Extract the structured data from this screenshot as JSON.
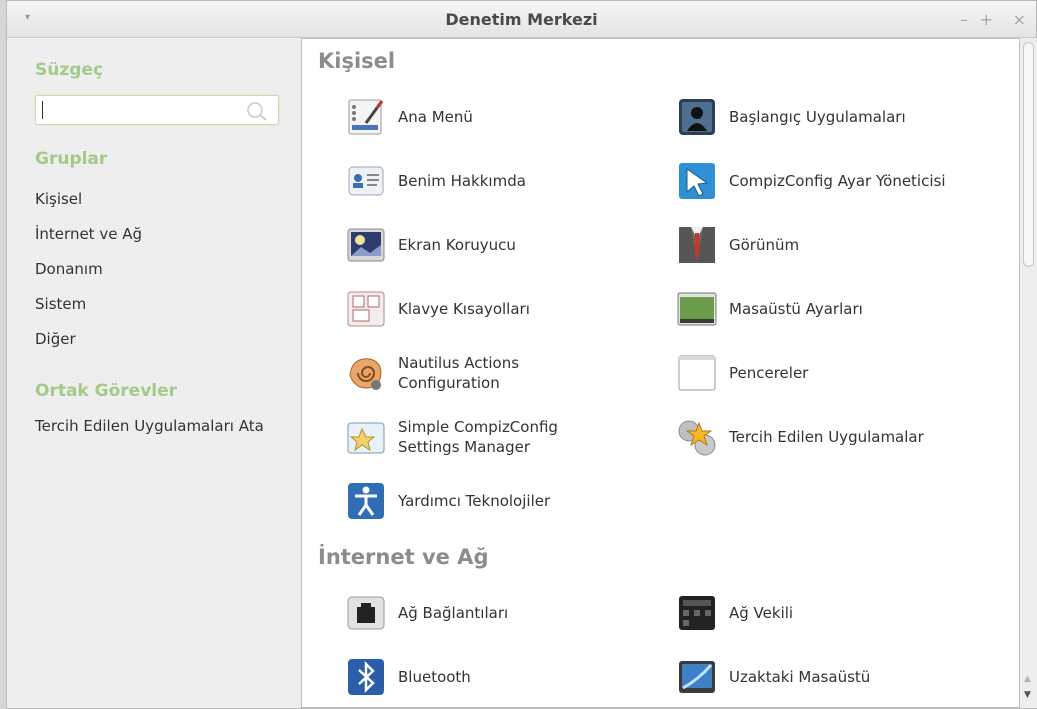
{
  "window": {
    "title": "Denetim Merkezi",
    "menu_glyph": "▾",
    "minimize_glyph": "–",
    "maximize_glyph": "+",
    "close_glyph": "×"
  },
  "sidebar": {
    "filter_heading": "Süzgeç",
    "search_value": "",
    "groups_heading": "Gruplar",
    "groups": [
      "Kişisel",
      "İnternet ve Ağ",
      "Donanım",
      "Sistem",
      "Diğer"
    ],
    "tasks_heading": "Ortak Görevler",
    "tasks": [
      "Tercih Edilen Uygulamaları Ata"
    ]
  },
  "sections": [
    {
      "title": "Kişisel",
      "items": [
        {
          "label": "Ana Menü",
          "icon": "main-menu-icon"
        },
        {
          "label": "Başlangıç Uygulamaları",
          "icon": "startup-apps-icon"
        },
        {
          "label": "Benim Hakkımda",
          "icon": "about-me-icon"
        },
        {
          "label": "CompizConfig Ayar Yöneticisi",
          "icon": "compizconfig-icon"
        },
        {
          "label": "Ekran Koruyucu",
          "icon": "screensaver-icon"
        },
        {
          "label": "Görünüm",
          "icon": "appearance-icon"
        },
        {
          "label": "Klavye Kısayolları",
          "icon": "keyboard-shortcuts-icon"
        },
        {
          "label": "Masaüstü Ayarları",
          "icon": "desktop-settings-icon"
        },
        {
          "label": "Nautilus Actions\nConfiguration",
          "icon": "nautilus-actions-icon"
        },
        {
          "label": "Pencereler",
          "icon": "windows-icon"
        },
        {
          "label": "Simple CompizConfig\nSettings Manager",
          "icon": "simple-ccsm-icon"
        },
        {
          "label": "Tercih Edilen Uygulamalar",
          "icon": "preferred-apps-icon"
        },
        {
          "label": "Yardımcı Teknolojiler",
          "icon": "accessibility-icon"
        }
      ]
    },
    {
      "title": "İnternet ve Ağ",
      "items": [
        {
          "label": "Ağ Bağlantıları",
          "icon": "network-connections-icon"
        },
        {
          "label": "Ağ Vekili",
          "icon": "network-proxy-icon"
        },
        {
          "label": "Bluetooth",
          "icon": "bluetooth-icon"
        },
        {
          "label": "Uzaktaki Masaüstü",
          "icon": "remote-desktop-icon"
        }
      ]
    }
  ]
}
